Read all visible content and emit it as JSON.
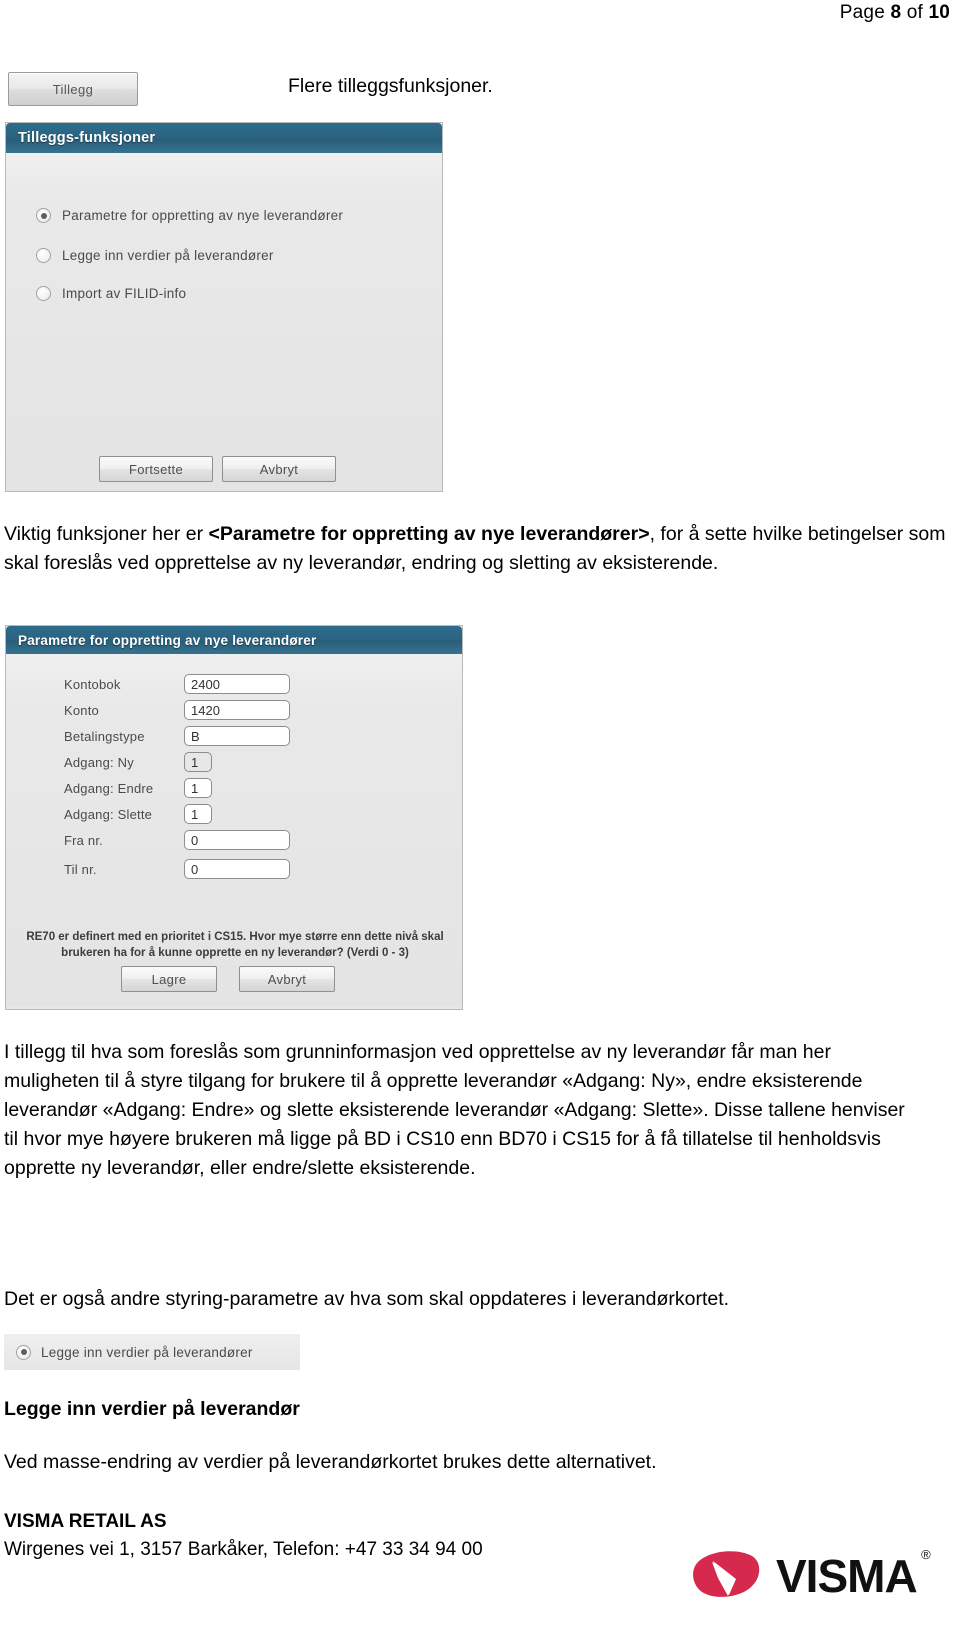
{
  "page_header": {
    "prefix": "Page ",
    "current": "8",
    "middle": " of ",
    "total": "10"
  },
  "tillegg_button": {
    "label": "Tillegg"
  },
  "intro_caption": "Flere tilleggsfunksjoner.",
  "dialog_tillegg": {
    "title": "Tilleggs-funksjoner",
    "options": [
      {
        "label": "Parametre for oppretting av nye leverandører",
        "checked": true
      },
      {
        "label": "Legge inn verdier på leverandører",
        "checked": false
      },
      {
        "label": "Import av FILID-info",
        "checked": false
      }
    ],
    "buttons": {
      "continue": "Fortsette",
      "cancel": "Avbryt"
    }
  },
  "paragraph_1": {
    "part_a": "Viktig funksjoner her er ",
    "bold": "<Parametre for oppretting av nye leverandører>",
    "part_b": ", for å sette hvilke betingelser som skal foreslås ved opprettelse av ny leverandør, endring og sletting av eksisterende."
  },
  "dialog_parametre": {
    "title": "Parametre for oppretting av nye leverandører",
    "fields": [
      {
        "label": "Kontobok",
        "value": "2400",
        "size": "wide",
        "selected": false
      },
      {
        "label": "Konto",
        "value": "1420",
        "size": "wide",
        "selected": false
      },
      {
        "label": "Betalingstype",
        "value": "B",
        "size": "wide",
        "selected": false
      },
      {
        "label": "Adgang: Ny",
        "value": "1",
        "size": "narrow",
        "selected": true
      },
      {
        "label": "Adgang: Endre",
        "value": "1",
        "size": "narrow",
        "selected": false
      },
      {
        "label": "Adgang: Slette",
        "value": "1",
        "size": "narrow",
        "selected": false
      },
      {
        "label": "Fra nr.",
        "value": "0",
        "size": "wide",
        "selected": false
      },
      {
        "label": "Til nr.",
        "value": "0",
        "size": "wide",
        "selected": false
      }
    ],
    "helper_line_1": "RE70 er definert med en prioritet i CS15. Hvor mye større enn dette nivå skal",
    "helper_line_2": "brukeren ha for å kunne opprette en ny leverandør? (Verdi 0 - 3)",
    "buttons": {
      "save": "Lagre",
      "cancel": "Avbryt"
    }
  },
  "paragraph_2": "I tillegg til hva som foreslås som grunninformasjon ved opprettelse av ny leverandør får man her muligheten til å styre tilgang for brukere til å opprette leverandør «Adgang: Ny», endre eksisterende leverandør «Adgang: Endre» og slette eksisterende leverandør «Adgang: Slette». Disse tallene henviser til hvor mye høyere brukeren må ligge på BD i CS10 enn BD70 i CS15 for å få tillatelse til henholdsvis opprette ny leverandør, eller endre/slette eksisterende.",
  "paragraph_3": "Det er også andre styring-parametre av hva som skal oppdateres i leverandørkortet.",
  "radio_chip": {
    "label": "Legge inn verdier på leverandører",
    "checked": true
  },
  "heading_legge_inn": "Legge inn verdier på leverandør",
  "paragraph_4": "Ved masse-endring av verdier på leverandørkortet brukes dette alternativet.",
  "footer": {
    "company": "VISMA RETAIL AS",
    "address": "Wirgenes vei 1, 3157 Barkåker, Telefon: +47 33 34 94 00",
    "logo_word": "VISMA",
    "logo_registered": "®",
    "logo_color": "#d6294e"
  }
}
